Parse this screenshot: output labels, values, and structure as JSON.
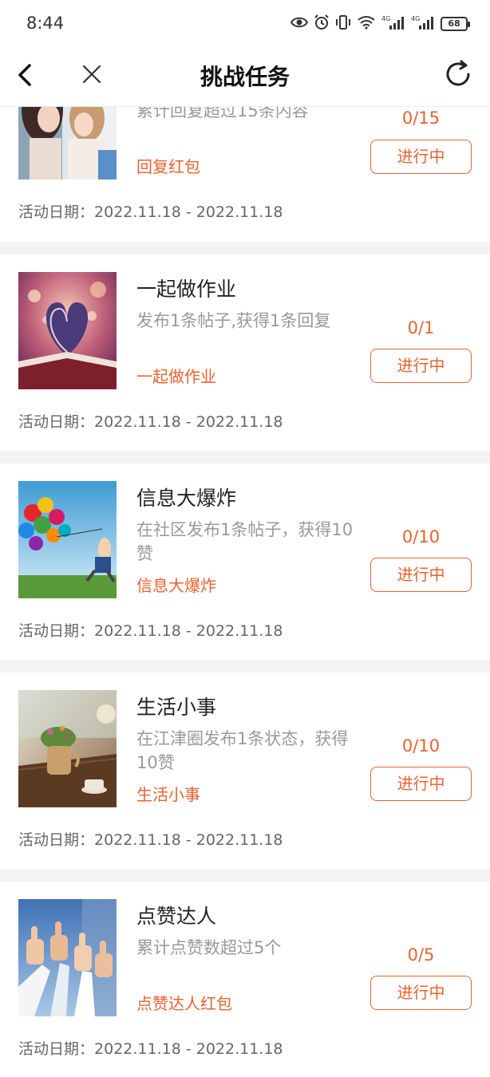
{
  "status_bar": {
    "time": "8:44",
    "battery": "68",
    "icons": [
      "eye-icon",
      "alarm-icon",
      "vibrate-icon",
      "wifi-icon",
      "signal-4g-icon",
      "signal-4g-icon",
      "battery-icon"
    ]
  },
  "nav": {
    "title": "挑战任务",
    "icons": [
      "back-arrow-icon",
      "close-icon",
      "refresh-icon"
    ]
  },
  "accent_color": "#e8622f",
  "tasks": [
    {
      "title": "",
      "desc": "累计回复超过15条内容",
      "reward": "回复红包",
      "progress": "0/15",
      "status": "进行中",
      "date_label": "活动日期：",
      "date_range": "2022.11.18 - 2022.11.18",
      "image": "two-girls-photo"
    },
    {
      "title": "一起做作业",
      "desc": "发布1条帖子,获得1条回复",
      "reward": "一起做作业",
      "progress": "0/1",
      "status": "进行中",
      "date_label": "活动日期：",
      "date_range": "2022.11.18 - 2022.11.18",
      "image": "heart-book-photo"
    },
    {
      "title": "信息大爆炸",
      "desc": "在社区发布1条帖子，获得10赞",
      "reward": "信息大爆炸",
      "progress": "0/10",
      "status": "进行中",
      "date_label": "活动日期：",
      "date_range": "2022.11.18 - 2022.11.18",
      "image": "balloons-photo"
    },
    {
      "title": "生活小事",
      "desc": "在江津圈发布1条状态，获得10赞",
      "reward": "生活小事",
      "progress": "0/10",
      "status": "进行中",
      "date_label": "活动日期：",
      "date_range": "2022.11.18 - 2022.11.18",
      "image": "teapot-table-photo"
    },
    {
      "title": "点赞达人",
      "desc": "累计点赞数超过5个",
      "reward": "点赞达人红包",
      "progress": "0/5",
      "status": "进行中",
      "date_label": "活动日期：",
      "date_range": "2022.11.18 - 2022.11.18",
      "image": "thumbs-up-photo"
    }
  ]
}
